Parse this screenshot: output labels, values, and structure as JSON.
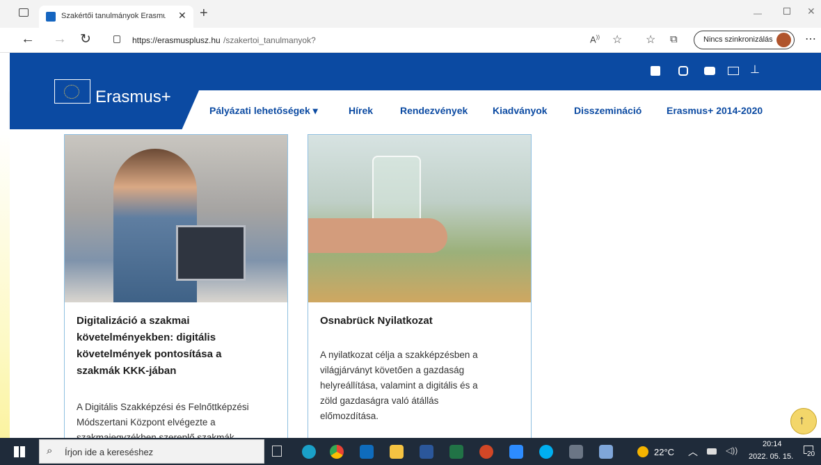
{
  "browser": {
    "tab_title": "Szakértői tanulmányok Erasmus+",
    "url_host": "https://erasmusplusz.hu",
    "url_path": "/szakertoi_tanulmanyok?",
    "sync_label": "Nincs szinkronizálás"
  },
  "site": {
    "logo_text": "Erasmus+",
    "nav": [
      {
        "label": "Pályázati lehetőségek ▾"
      },
      {
        "label": "Hírek"
      },
      {
        "label": "Rendezvények"
      },
      {
        "label": "Kiadványok"
      },
      {
        "label": "Disszemináció"
      },
      {
        "label": "Erasmus+ 2014-2020"
      }
    ]
  },
  "cards": [
    {
      "title_lines": [
        "Digitalizáció a szakmai",
        "követelményekben: digitális",
        "követelmények pontosítása a",
        "szakmák KKK-jában"
      ],
      "text_lines": [
        "A Digitális Szakképzési és Felnőttképzési",
        "Módszertani Központ elvégezte a",
        "szakmajegyzékben szereplő szakmák"
      ]
    },
    {
      "title_lines": [
        "Osnabrück Nyilatkozat"
      ],
      "text_lines": [
        "A nyilatkozat célja a szakképzésben a",
        "világjárványt követően a gazdaság",
        "helyreállítása, valamint a digitális és a",
        "zöld gazdaságra való átállás",
        "előmozdítása."
      ]
    }
  ],
  "taskbar": {
    "search_placeholder": "Írjon ide a kereséshez",
    "temperature": "22°C",
    "time": "20:14",
    "date": "2022. 05. 15.",
    "notification_count": "20"
  }
}
